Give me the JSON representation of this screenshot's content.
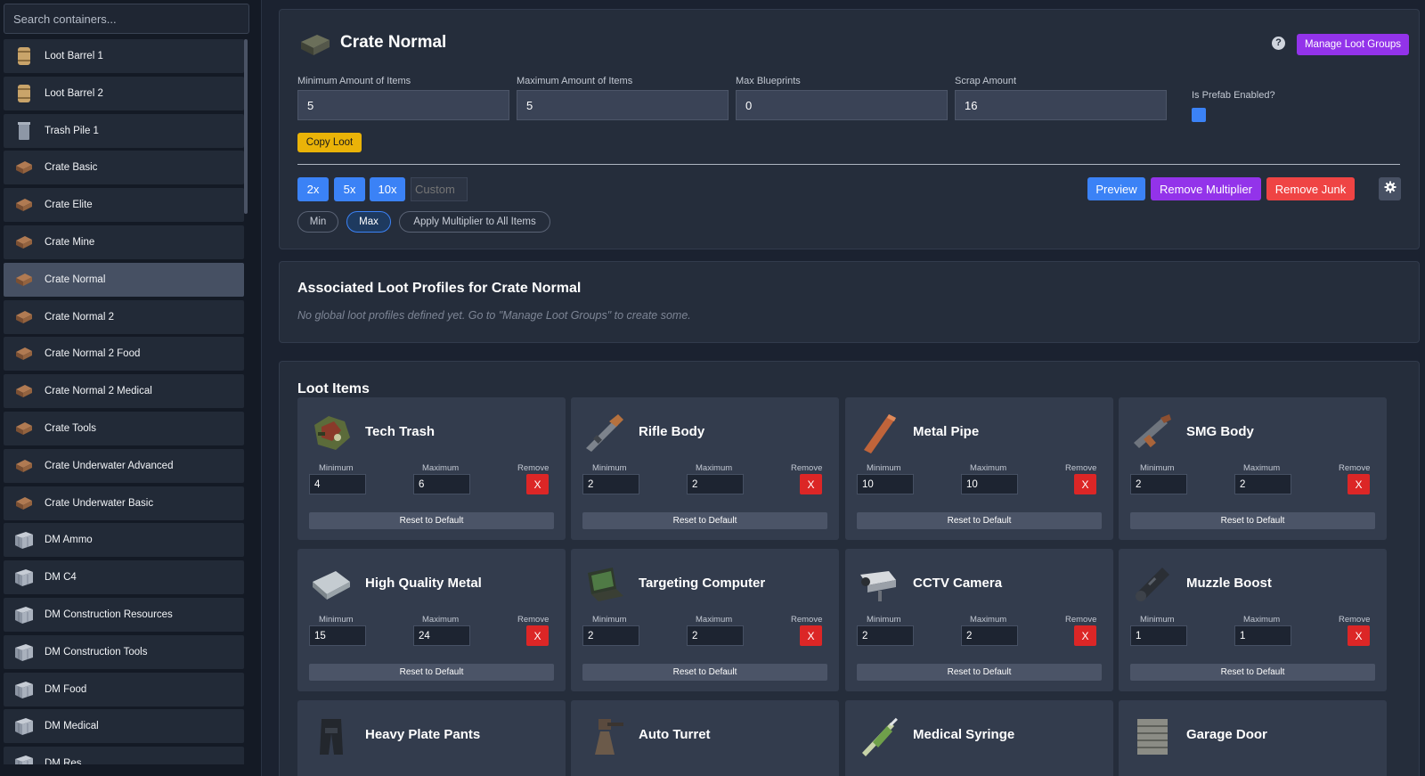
{
  "sidebar": {
    "search_placeholder": "Search containers...",
    "items": [
      {
        "label": "Loot Barrel 1",
        "icon": "barrel-icon"
      },
      {
        "label": "Loot Barrel 2",
        "icon": "barrel-icon"
      },
      {
        "label": "Trash Pile 1",
        "icon": "trash-can-icon"
      },
      {
        "label": "Crate Basic",
        "icon": "crate-icon"
      },
      {
        "label": "Crate Elite",
        "icon": "crate-icon"
      },
      {
        "label": "Crate Mine",
        "icon": "crate-icon"
      },
      {
        "label": "Crate Normal",
        "icon": "crate-icon",
        "selected": true
      },
      {
        "label": "Crate Normal 2",
        "icon": "crate-icon"
      },
      {
        "label": "Crate Normal 2 Food",
        "icon": "crate-icon"
      },
      {
        "label": "Crate Normal 2 Medical",
        "icon": "crate-icon"
      },
      {
        "label": "Crate Tools",
        "icon": "crate-icon"
      },
      {
        "label": "Crate Underwater Advanced",
        "icon": "crate-icon"
      },
      {
        "label": "Crate Underwater Basic",
        "icon": "crate-icon"
      },
      {
        "label": "DM Ammo",
        "icon": "metal-crate-icon"
      },
      {
        "label": "DM C4",
        "icon": "metal-crate-icon"
      },
      {
        "label": "DM Construction Resources",
        "icon": "metal-crate-icon"
      },
      {
        "label": "DM Construction Tools",
        "icon": "metal-crate-icon"
      },
      {
        "label": "DM Food",
        "icon": "metal-crate-icon"
      },
      {
        "label": "DM Medical",
        "icon": "metal-crate-icon"
      },
      {
        "label": "DM Res",
        "icon": "metal-crate-icon"
      }
    ]
  },
  "header": {
    "title": "Crate Normal",
    "manage_button": "Manage Loot Groups",
    "help": "?"
  },
  "fields": {
    "min_items": {
      "label": "Minimum Amount of Items",
      "value": "5"
    },
    "max_items": {
      "label": "Maximum Amount of Items",
      "value": "5"
    },
    "max_blueprints": {
      "label": "Max Blueprints",
      "value": "0"
    },
    "scrap": {
      "label": "Scrap Amount",
      "value": "16"
    },
    "prefab_enabled": {
      "label": "Is Prefab Enabled?",
      "checked": true
    }
  },
  "copy_loot": "Copy Loot",
  "multipliers": {
    "buttons": [
      "2x",
      "5x",
      "10x"
    ],
    "custom_placeholder": "Custom",
    "pills": [
      "Min",
      "Max",
      "Apply Multiplier to All Items"
    ],
    "active_pill": "Max"
  },
  "actions": {
    "preview": "Preview",
    "remove_multiplier": "Remove Multiplier",
    "remove_junk": "Remove Junk"
  },
  "colors": {
    "accent_blue": "#3b82f6",
    "purple": "#9333ea",
    "red": "#dc2626",
    "yellow": "#eab308"
  },
  "profiles": {
    "title": "Associated Loot Profiles for Crate Normal",
    "empty_message": "No global loot profiles defined yet. Go to \"Manage Loot Groups\" to create some."
  },
  "loot": {
    "title": "Loot Items",
    "min_label": "Minimum",
    "max_label": "Maximum",
    "remove_label": "Remove",
    "remove_button": "X",
    "reset_button": "Reset to Default",
    "items": [
      {
        "name": "Tech Trash",
        "min": "4",
        "max": "6",
        "icon": "tech-trash-icon"
      },
      {
        "name": "Rifle Body",
        "min": "2",
        "max": "2",
        "icon": "rifle-body-icon"
      },
      {
        "name": "Metal Pipe",
        "min": "10",
        "max": "10",
        "icon": "metal-pipe-icon"
      },
      {
        "name": "SMG Body",
        "min": "2",
        "max": "2",
        "icon": "smg-body-icon"
      },
      {
        "name": "High Quality Metal",
        "min": "15",
        "max": "24",
        "icon": "hq-metal-icon"
      },
      {
        "name": "Targeting Computer",
        "min": "2",
        "max": "2",
        "icon": "targeting-computer-icon"
      },
      {
        "name": "CCTV Camera",
        "min": "2",
        "max": "2",
        "icon": "cctv-camera-icon"
      },
      {
        "name": "Muzzle Boost",
        "min": "1",
        "max": "1",
        "icon": "muzzle-boost-icon"
      },
      {
        "name": "Heavy Plate Pants",
        "icon": "heavy-plate-pants-icon"
      },
      {
        "name": "Auto Turret",
        "icon": "auto-turret-icon"
      },
      {
        "name": "Medical Syringe",
        "icon": "medical-syringe-icon"
      },
      {
        "name": "Garage Door",
        "icon": "garage-door-icon"
      }
    ]
  }
}
